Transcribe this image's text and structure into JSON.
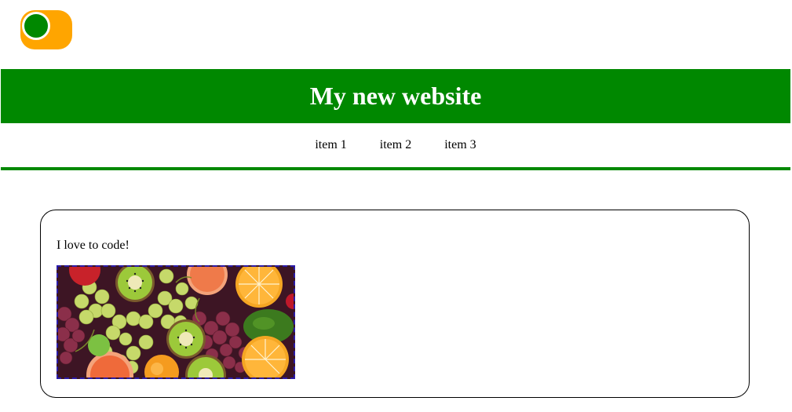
{
  "header": {
    "title": "My new website"
  },
  "nav": {
    "items": [
      {
        "label": "item 1"
      },
      {
        "label": "item 2"
      },
      {
        "label": "item 3"
      }
    ]
  },
  "main": {
    "text": "I love to code!",
    "image": {
      "alt": "fruit"
    }
  },
  "colors": {
    "brand_green": "#008800",
    "logo_orange": "#ffa500",
    "image_border": "#2a1aa8"
  }
}
